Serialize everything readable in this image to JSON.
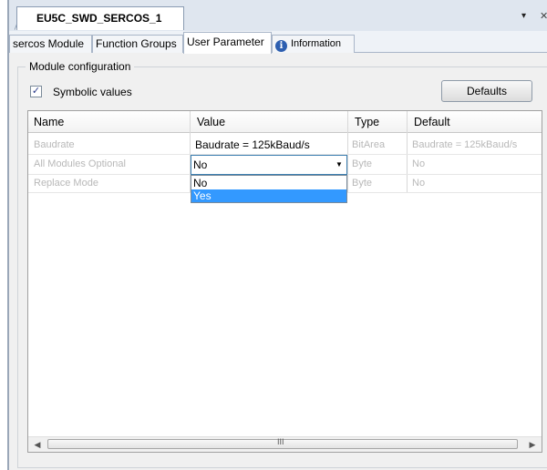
{
  "document_tab": {
    "title": "EU5C_SWD_SERCOS_1"
  },
  "title_bar": {
    "dropdown_icon": "chevron-down-icon",
    "close_icon": "close-icon",
    "dropdown_glyph": "▾",
    "close_glyph": "✕"
  },
  "tabs": [
    {
      "label": "sercos Module"
    },
    {
      "label": "Function Groups"
    },
    {
      "label": "User Parameter",
      "active": true
    },
    {
      "label": "Information",
      "icon": "info-icon"
    }
  ],
  "module_config": {
    "group_title": "Module configuration",
    "symbolic_values": {
      "label": "Symbolic values",
      "checked": true,
      "check_glyph": "✓"
    },
    "defaults_label": "Defaults"
  },
  "grid": {
    "columns": [
      "Name",
      "Value",
      "Type",
      "Default"
    ],
    "rows": [
      {
        "name": "Baudrate",
        "value": "Baudrate = 125kBaud/s",
        "type": "BitArea",
        "default": "Baudrate = 125kBaud/s"
      },
      {
        "name": "All Modules Optional",
        "value": "No",
        "type": "Byte",
        "default": "No"
      },
      {
        "name": "Replace Mode",
        "value": "",
        "type": "Byte",
        "default": "No"
      }
    ],
    "dropdown": {
      "selected": "No",
      "options": [
        "No",
        "Yes"
      ],
      "highlighted": "Yes",
      "arrow_glyph": "▼"
    },
    "scrollbar": {
      "left_glyph": "◀",
      "right_glyph": "▶",
      "grip_glyph": "III"
    }
  },
  "colors": {
    "selection": "#3399ff",
    "focus_border": "#3c7fb1"
  }
}
